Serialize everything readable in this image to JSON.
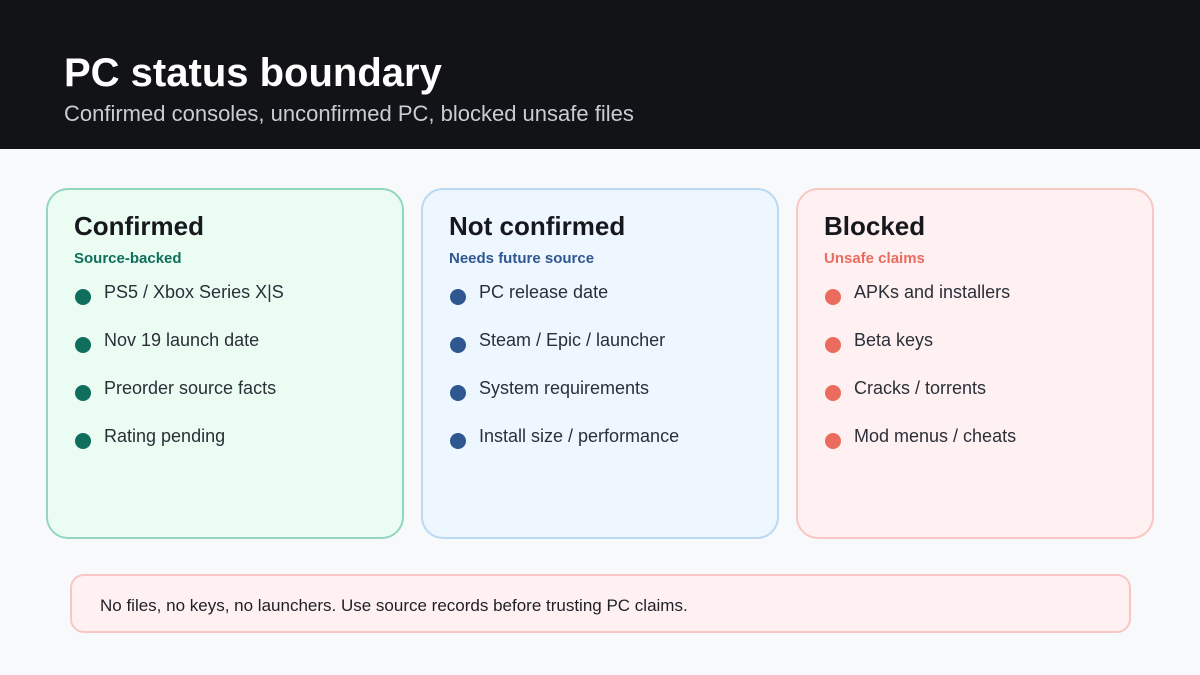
{
  "header": {
    "title": "PC status boundary",
    "subtitle": "Confirmed consoles, unconfirmed PC, blocked unsafe files"
  },
  "cards": [
    {
      "title": "Confirmed",
      "subtitle": "Source-backed",
      "accent": "#0f6e5c",
      "border": "#93d6bf",
      "background": "#ebfdf3",
      "items": [
        "PS5 / Xbox Series X|S",
        "Nov 19 launch date",
        "Preorder source facts",
        "Rating pending"
      ]
    },
    {
      "title": "Not confirmed",
      "subtitle": "Needs future source",
      "accent": "#2f5891",
      "border": "#b9d8f3",
      "background": "#eef6ff",
      "items": [
        "PC release date",
        "Steam / Epic / launcher",
        "System requirements",
        "Install size / performance"
      ]
    },
    {
      "title": "Blocked",
      "subtitle": "Unsafe claims",
      "accent": "#ec6b5f",
      "border": "#f8c7c3",
      "background": "#fff1f1",
      "items": [
        "APKs and installers",
        "Beta keys",
        "Cracks / torrents",
        "Mod menus / cheats"
      ]
    }
  ],
  "footer": {
    "text": "No files, no keys, no launchers. Use source records before trusting PC claims."
  }
}
